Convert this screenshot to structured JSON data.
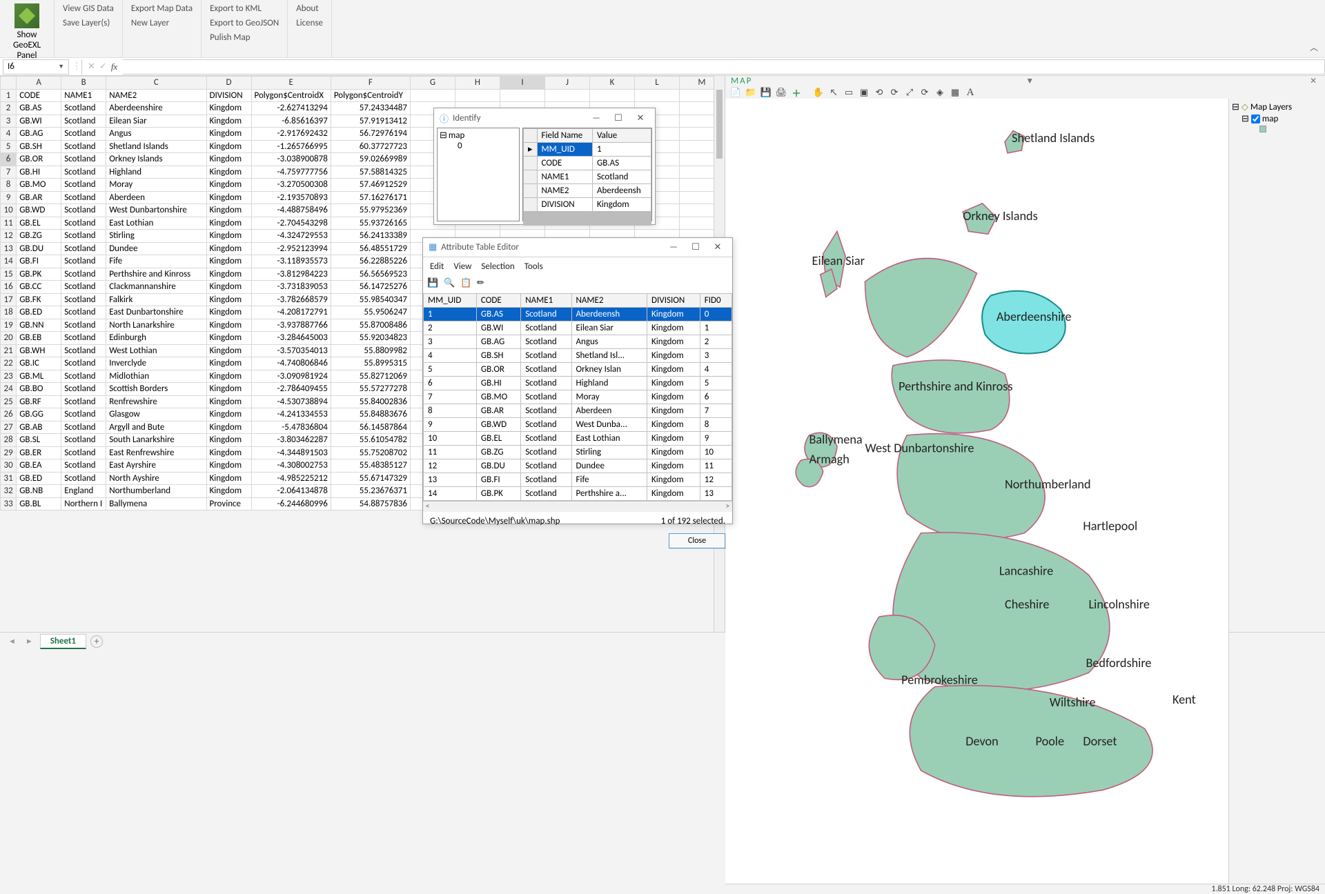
{
  "ribbon": {
    "big_button": "Show GeoEXL Panel",
    "group1": [
      "View GIS Data",
      "Save Layer(s)"
    ],
    "group2": [
      "Export Map Data",
      "New Layer"
    ],
    "group3": [
      "Export to KML",
      "Export to GeoJSON",
      "Pulish Map"
    ],
    "group4": [
      "About",
      "License"
    ]
  },
  "namebox": "I6",
  "sheet_tab": "Sheet1",
  "columns": [
    "A",
    "B",
    "C",
    "D",
    "E",
    "F",
    "G",
    "H",
    "I",
    "J",
    "K",
    "L",
    "M"
  ],
  "headers": [
    "CODE",
    "NAME1",
    "NAME2",
    "DIVISION",
    "Polygon$CentroidX",
    "Polygon$CentroidY"
  ],
  "rows": [
    [
      "GB.AS",
      "Scotland",
      "Aberdeenshire",
      "Kingdom",
      "-2.627413294",
      "57.24334487"
    ],
    [
      "GB.WI",
      "Scotland",
      "Eilean Siar",
      "Kingdom",
      "-6.85616397",
      "57.91913412"
    ],
    [
      "GB.AG",
      "Scotland",
      "Angus",
      "Kingdom",
      "-2.917692432",
      "56.72976194"
    ],
    [
      "GB.SH",
      "Scotland",
      "Shetland Islands",
      "Kingdom",
      "-1.265766995",
      "60.37727723"
    ],
    [
      "GB.OR",
      "Scotland",
      "Orkney Islands",
      "Kingdom",
      "-3.038900878",
      "59.02669989"
    ],
    [
      "GB.HI",
      "Scotland",
      "Highland",
      "Kingdom",
      "-4.759777756",
      "57.58814325"
    ],
    [
      "GB.MO",
      "Scotland",
      "Moray",
      "Kingdom",
      "-3.270500308",
      "57.46912529"
    ],
    [
      "GB.AR",
      "Scotland",
      "Aberdeen",
      "Kingdom",
      "-2.193570893",
      "57.16276171"
    ],
    [
      "GB.WD",
      "Scotland",
      "West Dunbartonshire",
      "Kingdom",
      "-4.488758496",
      "55.97952369"
    ],
    [
      "GB.EL",
      "Scotland",
      "East Lothian",
      "Kingdom",
      "-2.704543298",
      "55.93726165"
    ],
    [
      "GB.ZG",
      "Scotland",
      "Stirling",
      "Kingdom",
      "-4.324729553",
      "56.24133389"
    ],
    [
      "GB.DU",
      "Scotland",
      "Dundee",
      "Kingdom",
      "-2.952123994",
      "56.48551729"
    ],
    [
      "GB.FI",
      "Scotland",
      "Fife",
      "Kingdom",
      "-3.118935573",
      "56.22885226"
    ],
    [
      "GB.PK",
      "Scotland",
      "Perthshire and Kinross",
      "Kingdom",
      "-3.812984223",
      "56.56569523"
    ],
    [
      "GB.CC",
      "Scotland",
      "Clackmannanshire",
      "Kingdom",
      "-3.731839053",
      "56.14725276"
    ],
    [
      "GB.FK",
      "Scotland",
      "Falkirk",
      "Kingdom",
      "-3.782668579",
      "55.98540347"
    ],
    [
      "GB.ED",
      "Scotland",
      "East Dunbartonshire",
      "Kingdom",
      "-4.208172791",
      "55.9506247"
    ],
    [
      "GB.NN",
      "Scotland",
      "North Lanarkshire",
      "Kingdom",
      "-3.937887766",
      "55.87008486"
    ],
    [
      "GB.EB",
      "Scotland",
      "Edinburgh",
      "Kingdom",
      "-3.284645003",
      "55.92034823"
    ],
    [
      "GB.WH",
      "Scotland",
      "West Lothian",
      "Kingdom",
      "-3.570354013",
      "55.8809982"
    ],
    [
      "GB.IC",
      "Scotland",
      "Inverclyde",
      "Kingdom",
      "-4.740806846",
      "55.8995315"
    ],
    [
      "GB.ML",
      "Scotland",
      "Midlothian",
      "Kingdom",
      "-3.090981924",
      "55.82712069"
    ],
    [
      "GB.BO",
      "Scotland",
      "Scottish Borders",
      "Kingdom",
      "-2.786409455",
      "55.57277278"
    ],
    [
      "GB.RF",
      "Scotland",
      "Renfrewshire",
      "Kingdom",
      "-4.530738894",
      "55.84002836"
    ],
    [
      "GB.GG",
      "Scotland",
      "Glasgow",
      "Kingdom",
      "-4.241334553",
      "55.84883676"
    ],
    [
      "GB.AB",
      "Scotland",
      "Argyll and Bute",
      "Kingdom",
      "-5.47836804",
      "56.14587864"
    ],
    [
      "GB.SL",
      "Scotland",
      "South Lanarkshire",
      "Kingdom",
      "-3.803462287",
      "55.61054782"
    ],
    [
      "GB.ER",
      "Scotland",
      "East Renfrewshire",
      "Kingdom",
      "-4.344891503",
      "55.75208702"
    ],
    [
      "GB.EA",
      "Scotland",
      "East Ayrshire",
      "Kingdom",
      "-4.308002753",
      "55.48385127"
    ],
    [
      "GB.ED",
      "Scotland",
      "North Ayshire",
      "Kingdom",
      "-4.985225212",
      "55.67147329"
    ],
    [
      "GB.NB",
      "England",
      "Northumberland",
      "Kingdom",
      "-2.064134878",
      "55.23676371"
    ],
    [
      "GB.BL",
      "Northern I",
      "Ballymena",
      "Province",
      "-6.244680996",
      "54.88757836"
    ]
  ],
  "identify": {
    "title": "Identify",
    "tree_root": "map",
    "tree_leaf": "0",
    "col1": "Field Name",
    "col2": "Value",
    "rows": [
      [
        "MM_UID",
        "1"
      ],
      [
        "CODE",
        "GB.AS"
      ],
      [
        "NAME1",
        "Scotland"
      ],
      [
        "NAME2",
        "Aberdeensh"
      ],
      [
        "DIVISION",
        "Kingdom"
      ]
    ]
  },
  "attr": {
    "title": "Attribute Table Editor",
    "menu": [
      "Edit",
      "View",
      "Selection",
      "Tools"
    ],
    "cols": [
      "MM_UID",
      "CODE",
      "NAME1",
      "NAME2",
      "DIVISION",
      "FID0"
    ],
    "rows": [
      [
        "1",
        "GB.AS",
        "Scotland",
        "Aberdeensh",
        "Kingdom",
        "0"
      ],
      [
        "2",
        "GB.WI",
        "Scotland",
        "Eilean Siar",
        "Kingdom",
        "1"
      ],
      [
        "3",
        "GB.AG",
        "Scotland",
        "Angus",
        "Kingdom",
        "2"
      ],
      [
        "4",
        "GB.SH",
        "Scotland",
        "Shetland Isl...",
        "Kingdom",
        "3"
      ],
      [
        "5",
        "GB.OR",
        "Scotland",
        "Orkney Islan",
        "Kingdom",
        "4"
      ],
      [
        "6",
        "GB.HI",
        "Scotland",
        "Highland",
        "Kingdom",
        "5"
      ],
      [
        "7",
        "GB.MO",
        "Scotland",
        "Moray",
        "Kingdom",
        "6"
      ],
      [
        "8",
        "GB.AR",
        "Scotland",
        "Aberdeen",
        "Kingdom",
        "7"
      ],
      [
        "9",
        "GB.WD",
        "Scotland",
        "West Dunba...",
        "Kingdom",
        "8"
      ],
      [
        "10",
        "GB.EL",
        "Scotland",
        "East Lothian",
        "Kingdom",
        "9"
      ],
      [
        "11",
        "GB.ZG",
        "Scotland",
        "Stirling",
        "Kingdom",
        "10"
      ],
      [
        "12",
        "GB.DU",
        "Scotland",
        "Dundee",
        "Kingdom",
        "11"
      ],
      [
        "13",
        "GB.FI",
        "Scotland",
        "Fife",
        "Kingdom",
        "12"
      ],
      [
        "14",
        "GB.PK",
        "Scotland",
        "Perthshire a...",
        "Kingdom",
        "13"
      ]
    ],
    "path": "G:\\SourceCode\\Myself\\uk\\map.shp",
    "status": "1 of 192 selected.",
    "close": "Close"
  },
  "map": {
    "title": "MAP",
    "layers_header": "Map Layers",
    "layer1": "map",
    "status": "1.851  Long:  62.248  Proj:  WGS84",
    "labels": [
      "Shetland Islands",
      "Orkney Islands",
      "Eilean Siar",
      "Aberdeenshire",
      "Perthshire and Kinross",
      "West Dunbartonshire",
      "Northumberland",
      "Hartlepool",
      "Lancashire",
      "Cheshire",
      "Lincolnshire",
      "Bedfordshire",
      "Pembrokeshire",
      "Wiltshire",
      "Kent",
      "Devon",
      "Poole",
      "Dorset",
      "Armagh",
      "Ballymena"
    ]
  }
}
